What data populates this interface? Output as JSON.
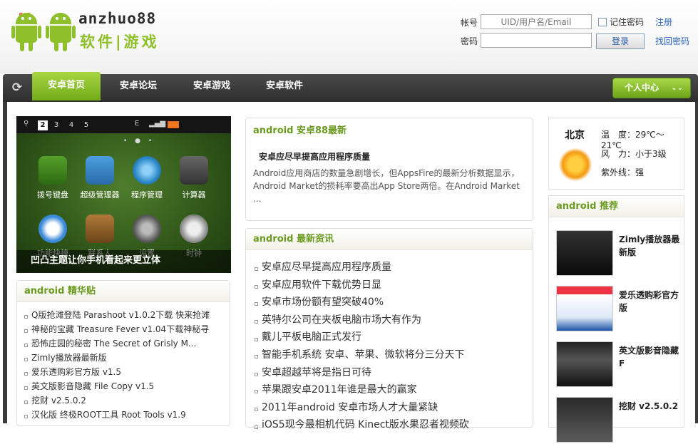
{
  "logo": {
    "wordmark": "anzhuo88",
    "tagline": "软件|游戏"
  },
  "login": {
    "account_label": "帐号",
    "account_placeholder": "UID/用户名/Email",
    "password_label": "密码",
    "remember_label": "记住密码",
    "login_button": "登录",
    "register_link": "注册",
    "forgot_link": "找回密码"
  },
  "nav": {
    "items": [
      {
        "label": "安卓首页",
        "active": true
      },
      {
        "label": "安卓论坛"
      },
      {
        "label": "安卓游戏"
      },
      {
        "label": "安卓软件"
      }
    ],
    "user_center": "个人中心"
  },
  "slideshow": {
    "pages": [
      "2",
      "3",
      "4",
      "5"
    ],
    "active_page": "2",
    "caption": "凹凸主题让你手机看起来更立体",
    "apps": [
      "拨号键盘",
      "超级管理器",
      "程序管理",
      "计算器",
      "功能快捷",
      "联系人",
      "设置",
      "时钟"
    ]
  },
  "jinghua": {
    "title": "android 精华贴",
    "items": [
      "Q版抢滩登陆 Parashoot v1.0.2下载 快来抢滩",
      "神秘的宝藏 Treasure Fever v1.04下载神秘寻",
      "恐怖庄园的秘密 The Secret of Grisly M...",
      "Zimly播放器最新版",
      "爱乐透购彩官方版 v1.5",
      "英文版影音隐藏 File Copy v1.5",
      "挖财 v2.5.0.2",
      "汉化版 终极ROOT工具 Root Tools v1.9"
    ]
  },
  "latest": {
    "title": "android 安卓88最新",
    "headline": "安卓应尽早提高应用程序质量",
    "summary": "Android应用商店的数量急剧增长，但AppsFire的最新分析数据显示，Android Market的损耗率要高出App Store两倍。在Android Market ..."
  },
  "news": {
    "title": "android 最新资讯",
    "items": [
      "安卓应尽早提高应用程序质量",
      "安卓应用软件下载优势日显",
      "安卓市场份额有望突破40%",
      "英特尔公司在夹板电脑市场大有作为",
      "戴儿平板电脑正式发行",
      "智能手机系统 安卓、苹果、微软将分三分天下",
      "安卓超越苹将是指日可待",
      "苹果跟安卓2011年谁是最大的赢家",
      "2011年android 安卓市场人才大量紧缺",
      "iOS5现今最相机代码 Kinect版水果忍者视频砍"
    ]
  },
  "weather": {
    "city": "北京",
    "temp_label": "温　度：",
    "temp_value": "29℃～21℃",
    "wind_label": "风　力：",
    "wind_value": "小于3级",
    "uv_label": "紫外线：",
    "uv_value": "强",
    "icon": "sunny-icon"
  },
  "recommend": {
    "title": "android 推荐",
    "items": [
      {
        "name": "Zimly播放器最新版"
      },
      {
        "name": "爱乐透购彩官方版"
      },
      {
        "name": "英文版影音隐藏 F"
      },
      {
        "name": "挖财 v2.5.0.2"
      }
    ]
  },
  "colors": {
    "brand_green": "#8fbf2a",
    "nav_dark": "#3a3a3a",
    "heading_green": "#6a9a1f"
  }
}
